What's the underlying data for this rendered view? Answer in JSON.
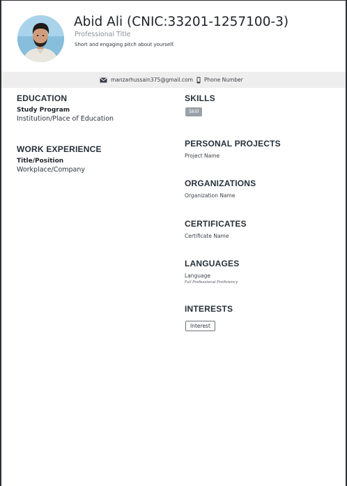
{
  "profile": {
    "name": "Abid Ali (CNIC:33201-1257100-3)",
    "title": "Professional Title",
    "pitch": "Short and engaging pitch about yourself.",
    "avatar_icon": "person-photo"
  },
  "contact": {
    "email": "manzarhussain375@gmail.com",
    "phone": "Phone Number",
    "email_icon": "envelope-icon",
    "phone_icon": "mobile-phone-icon"
  },
  "education": {
    "heading": "EDUCATION",
    "program": "Study Program",
    "institution": "Institution/Place of Education"
  },
  "work": {
    "heading": "WORK EXPERIENCE",
    "position": "Title/Position",
    "workplace": "Workplace/Company"
  },
  "skills": {
    "heading": "SKILLS",
    "items": [
      "Skill"
    ]
  },
  "projects": {
    "heading": "PERSONAL PROJECTS",
    "name": "Project Name"
  },
  "organizations": {
    "heading": "ORGANIZATIONS",
    "name": "Organization Name"
  },
  "certificates": {
    "heading": "CERTIFICATES",
    "name": "Certificate Name"
  },
  "languages": {
    "heading": "LANGUAGES",
    "language": "Language",
    "proficiency": "Full Professional Proficiency"
  },
  "interests": {
    "heading": "INTERESTS",
    "items": [
      "Interest"
    ]
  },
  "colors": {
    "contact_bar": "#eeeeee",
    "skill_tag": "#9aa0a8",
    "heading": "#263039"
  }
}
